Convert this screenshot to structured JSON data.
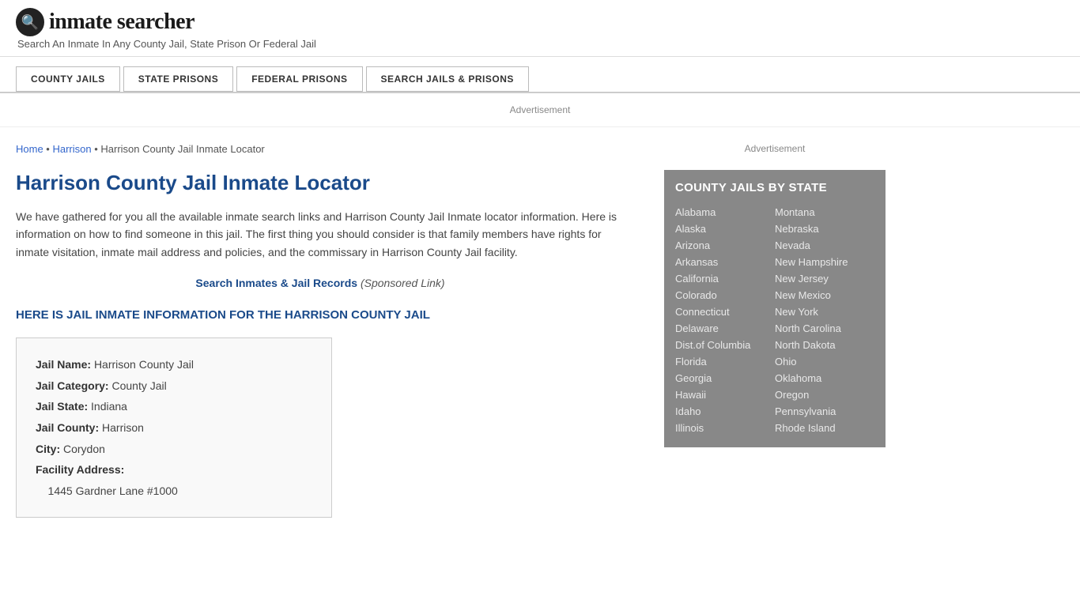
{
  "header": {
    "logo_icon": "🔍",
    "logo_text": "inmate searcher",
    "tagline": "Search An Inmate In Any County Jail, State Prison Or Federal Jail"
  },
  "nav": {
    "items": [
      {
        "label": "COUNTY JAILS",
        "active": true
      },
      {
        "label": "STATE PRISONS",
        "active": false
      },
      {
        "label": "FEDERAL PRISONS",
        "active": false
      },
      {
        "label": "SEARCH JAILS & PRISONS",
        "active": false
      }
    ]
  },
  "ad_banner": "Advertisement",
  "breadcrumb": {
    "home": "Home",
    "parent": "Harrison",
    "current": "Harrison County Jail Inmate Locator"
  },
  "page_title": "Harrison County Jail Inmate Locator",
  "description": "We have gathered for you all the available inmate search links and Harrison County Jail Inmate locator information. Here is information on how to find someone in this jail. The first thing you should consider is that family members have rights for inmate visitation, inmate mail address and policies, and the commissary in Harrison County Jail facility.",
  "search_link": {
    "label": "Search Inmates & Jail Records",
    "sponsored": "(Sponsored Link)"
  },
  "subheading": "HERE IS JAIL INMATE INFORMATION FOR THE HARRISON COUNTY JAIL",
  "info_box": {
    "fields": [
      {
        "label": "Jail Name:",
        "value": "Harrison County Jail"
      },
      {
        "label": "Jail Category:",
        "value": "County Jail"
      },
      {
        "label": "Jail State:",
        "value": "Indiana"
      },
      {
        "label": "Jail County:",
        "value": "Harrison"
      },
      {
        "label": "City:",
        "value": "Corydon"
      },
      {
        "label": "Facility Address:",
        "value": ""
      },
      {
        "label": "",
        "value": "1445 Gardner Lane #1000"
      }
    ]
  },
  "sidebar": {
    "ad_label": "Advertisement",
    "state_widget": {
      "header": "COUNTY JAILS BY STATE",
      "col1": [
        "Alabama",
        "Alaska",
        "Arizona",
        "Arkansas",
        "California",
        "Colorado",
        "Connecticut",
        "Delaware",
        "Dist.of Columbia",
        "Florida",
        "Georgia",
        "Hawaii",
        "Idaho",
        "Illinois"
      ],
      "col2": [
        "Montana",
        "Nebraska",
        "Nevada",
        "New Hampshire",
        "New Jersey",
        "New Mexico",
        "New York",
        "North Carolina",
        "North Dakota",
        "Ohio",
        "Oklahoma",
        "Oregon",
        "Pennsylvania",
        "Rhode Island"
      ]
    }
  }
}
